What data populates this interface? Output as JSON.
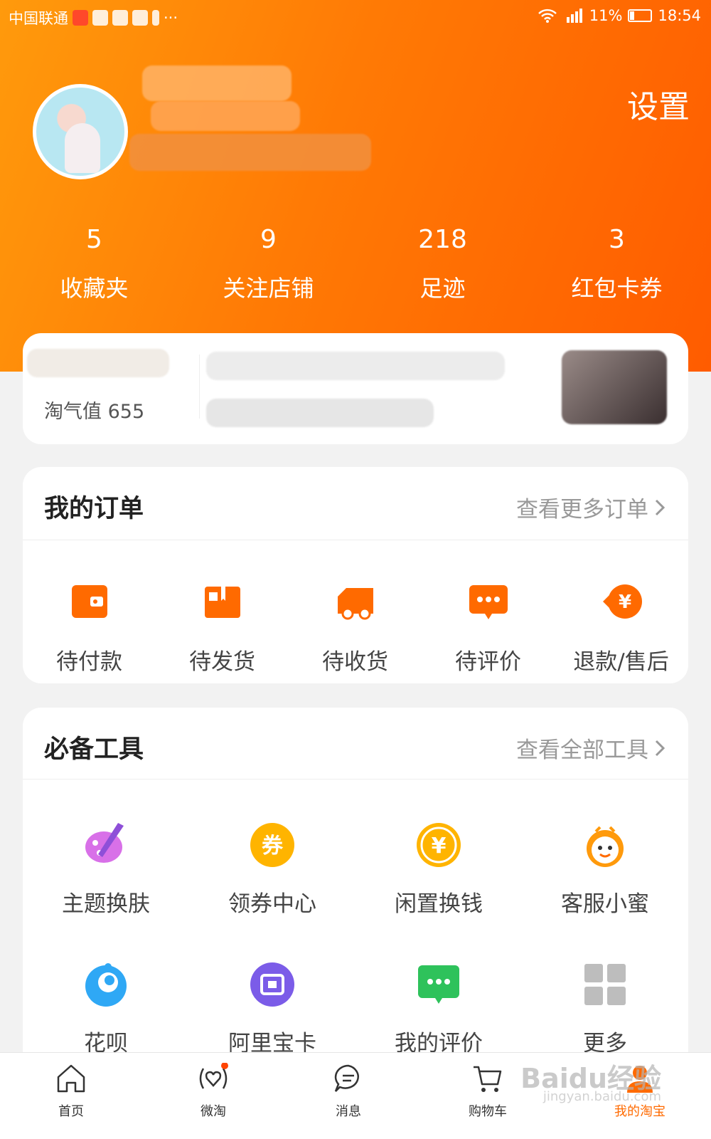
{
  "status_bar": {
    "carrier": "中国联通",
    "more": "···",
    "battery": "11%",
    "time": "18:54"
  },
  "header": {
    "settings_label": "设置"
  },
  "stats": [
    {
      "num": "5",
      "label": "收藏夹"
    },
    {
      "num": "9",
      "label": "关注店铺"
    },
    {
      "num": "218",
      "label": "足迹"
    },
    {
      "num": "3",
      "label": "红包卡券"
    }
  ],
  "member": {
    "points_label": "淘气值 655"
  },
  "orders": {
    "title": "我的订单",
    "more": "查看更多订单",
    "items": [
      {
        "label": "待付款",
        "icon": "wallet-icon"
      },
      {
        "label": "待发货",
        "icon": "package-icon"
      },
      {
        "label": "待收货",
        "icon": "truck-icon"
      },
      {
        "label": "待评价",
        "icon": "comment-icon"
      },
      {
        "label": "退款/售后",
        "icon": "refund-icon"
      }
    ]
  },
  "tools": {
    "title": "必备工具",
    "more": "查看全部工具",
    "items": [
      {
        "label": "主题换肤",
        "icon": "palette-icon"
      },
      {
        "label": "领券中心",
        "icon": "coupon-icon"
      },
      {
        "label": "闲置换钱",
        "icon": "yuan-coin-icon"
      },
      {
        "label": "客服小蜜",
        "icon": "bee-icon"
      },
      {
        "label": "花呗",
        "icon": "huabei-icon"
      },
      {
        "label": "阿里宝卡",
        "icon": "sim-card-icon"
      },
      {
        "label": "我的评价",
        "icon": "chat-bubble-icon"
      },
      {
        "label": "更多",
        "icon": "grid-icon"
      }
    ]
  },
  "tabbar": {
    "items": [
      {
        "label": "首页",
        "icon": "home-icon"
      },
      {
        "label": "微淘",
        "icon": "weitao-icon"
      },
      {
        "label": "消息",
        "icon": "message-icon"
      },
      {
        "label": "购物车",
        "icon": "cart-icon"
      },
      {
        "label": "我的淘宝",
        "icon": "profile-icon"
      }
    ]
  },
  "watermark": {
    "main": "Baidu经验",
    "sub": "jingyan.baidu.com"
  },
  "colors": {
    "accent": "#ff6a00",
    "header_start": "#ff9a0c",
    "header_end": "#ff5c00"
  }
}
